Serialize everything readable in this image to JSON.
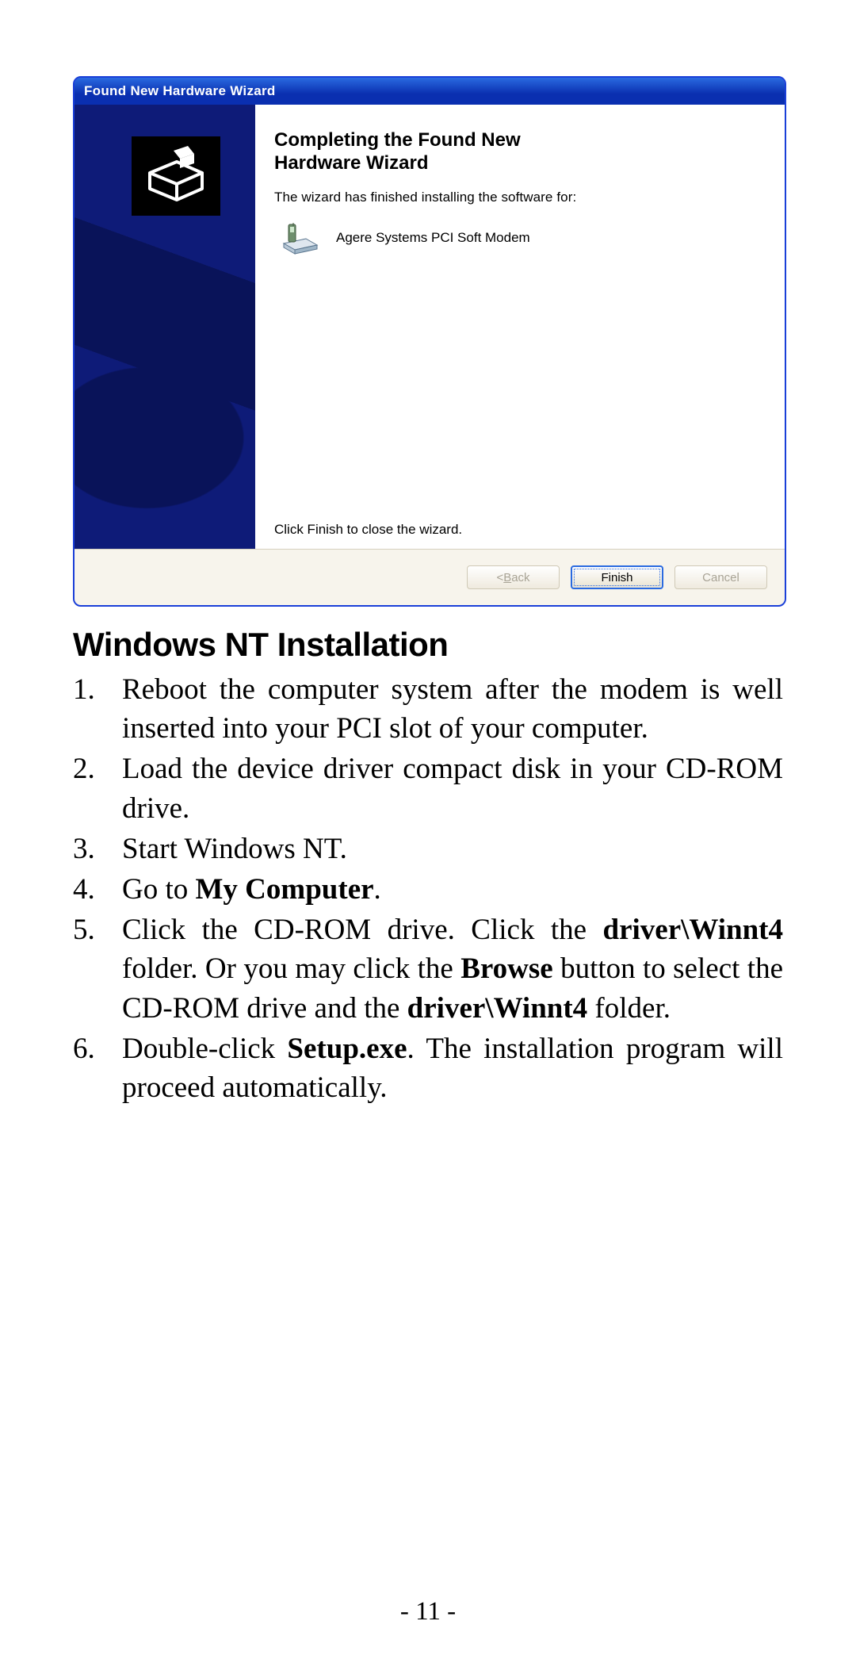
{
  "dialog": {
    "title": "Found New Hardware Wizard",
    "heading_line1": "Completing the Found New",
    "heading_line2": "Hardware Wizard",
    "subtext": "The wizard has finished installing the software for:",
    "device_name": "Agere Systems PCI Soft Modem",
    "bottom_note": "Click Finish to close the wizard.",
    "buttons": {
      "back_prefix": "< ",
      "back_mnemonic": "B",
      "back_rest": "ack",
      "finish": "Finish",
      "cancel": "Cancel"
    }
  },
  "section_heading": "Windows NT Installation",
  "steps": {
    "s1": "Reboot the computer system after the modem is well inserted into your PCI slot of your computer.",
    "s2": "Load the device driver compact disk in your CD-ROM drive.",
    "s3": "Start Windows NT.",
    "s4_a": "Go to ",
    "s4_b": "My Computer",
    "s4_c": ".",
    "s5_a": "Click the CD-ROM drive. Click the ",
    "s5_b": "driver\\Winnt4",
    "s5_c": " folder. Or you may click the ",
    "s5_d": "Browse",
    "s5_e": " button to select the CD-ROM drive and the ",
    "s5_f": "driver\\Winnt4",
    "s5_g": " folder.",
    "s6_a": "Double-click ",
    "s6_b": "Setup.exe",
    "s6_c": ". The installation program will proceed automatically."
  },
  "page_number": "- 11 -"
}
